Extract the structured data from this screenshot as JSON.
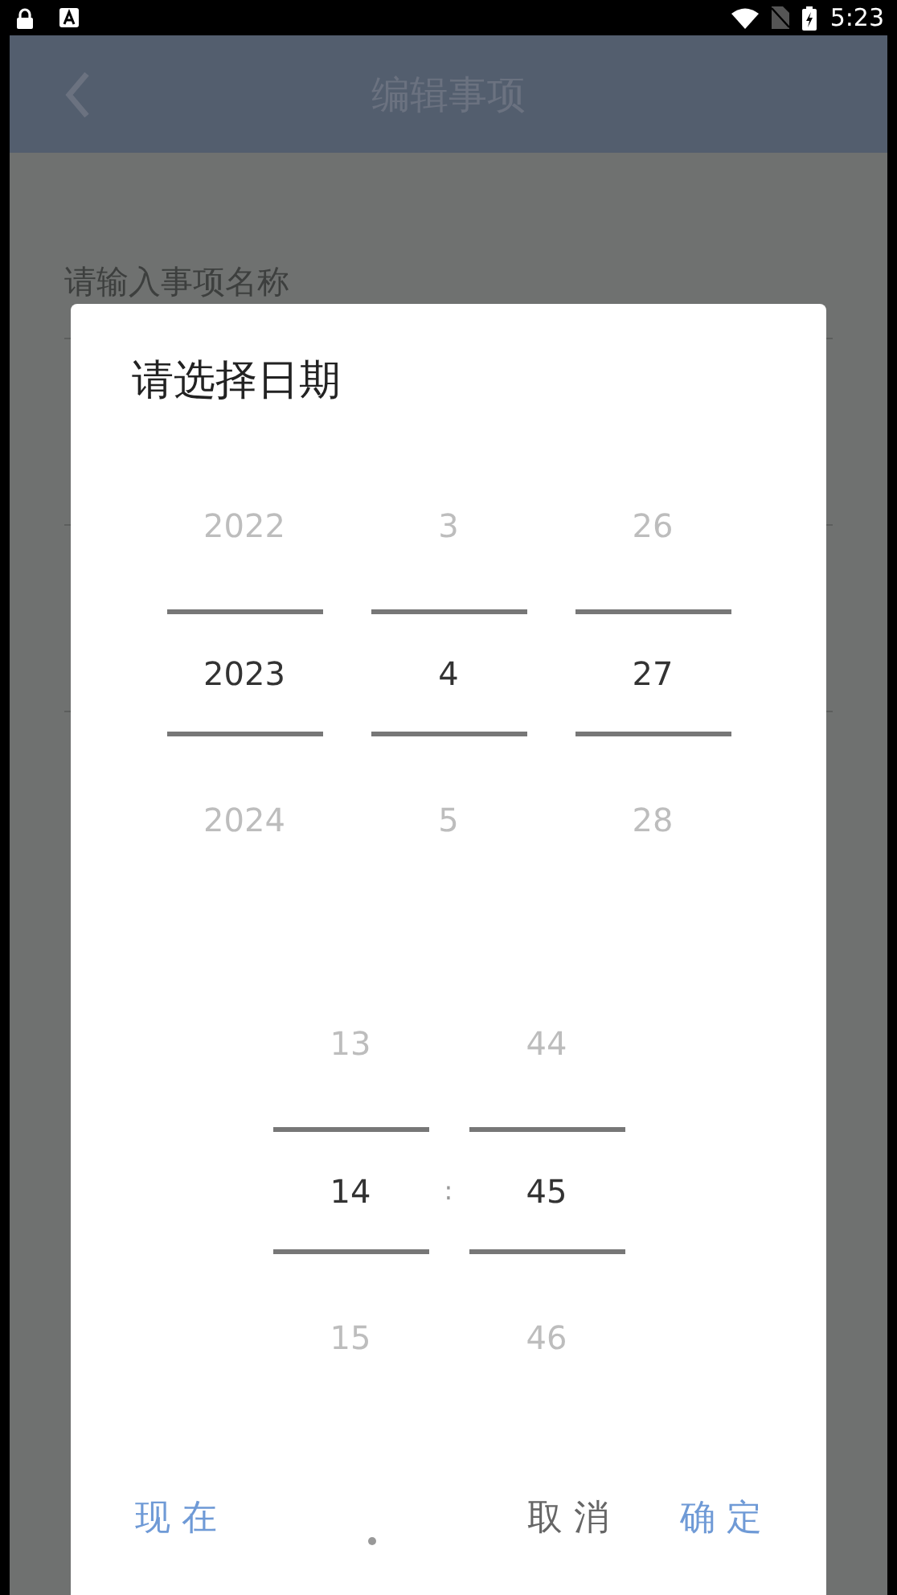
{
  "status_bar": {
    "time": "5:23"
  },
  "app_bar": {
    "title": "编辑事项"
  },
  "form": {
    "fields": [
      {
        "placeholder": "请输入事项名称"
      }
    ]
  },
  "dialog": {
    "title": "请选择日期",
    "date_columns": [
      {
        "items": [
          {
            "text": "2022",
            "selected": false
          },
          {
            "text": "2023",
            "selected": true
          },
          {
            "text": "2024",
            "selected": false
          }
        ]
      },
      {
        "items": [
          {
            "text": "3",
            "selected": false
          },
          {
            "text": "4",
            "selected": true
          },
          {
            "text": "5",
            "selected": false
          }
        ]
      },
      {
        "items": [
          {
            "text": "26",
            "selected": false
          },
          {
            "text": "27",
            "selected": true
          },
          {
            "text": "28",
            "selected": false
          }
        ]
      }
    ],
    "time_columns": [
      {
        "items": [
          {
            "text": "13",
            "selected": false
          },
          {
            "text": "14",
            "selected": true
          },
          {
            "text": "15",
            "selected": false
          }
        ]
      },
      {
        "items": [
          {
            "text": "44",
            "selected": false
          },
          {
            "text": "45",
            "selected": true
          },
          {
            "text": "46",
            "selected": false
          }
        ]
      }
    ],
    "time_separator": ":",
    "buttons": [
      {
        "label": "现 在",
        "kind": "accent"
      },
      {
        "label": "取 消",
        "kind": "neutral"
      },
      {
        "label": "确 定",
        "kind": "accent"
      }
    ]
  }
}
